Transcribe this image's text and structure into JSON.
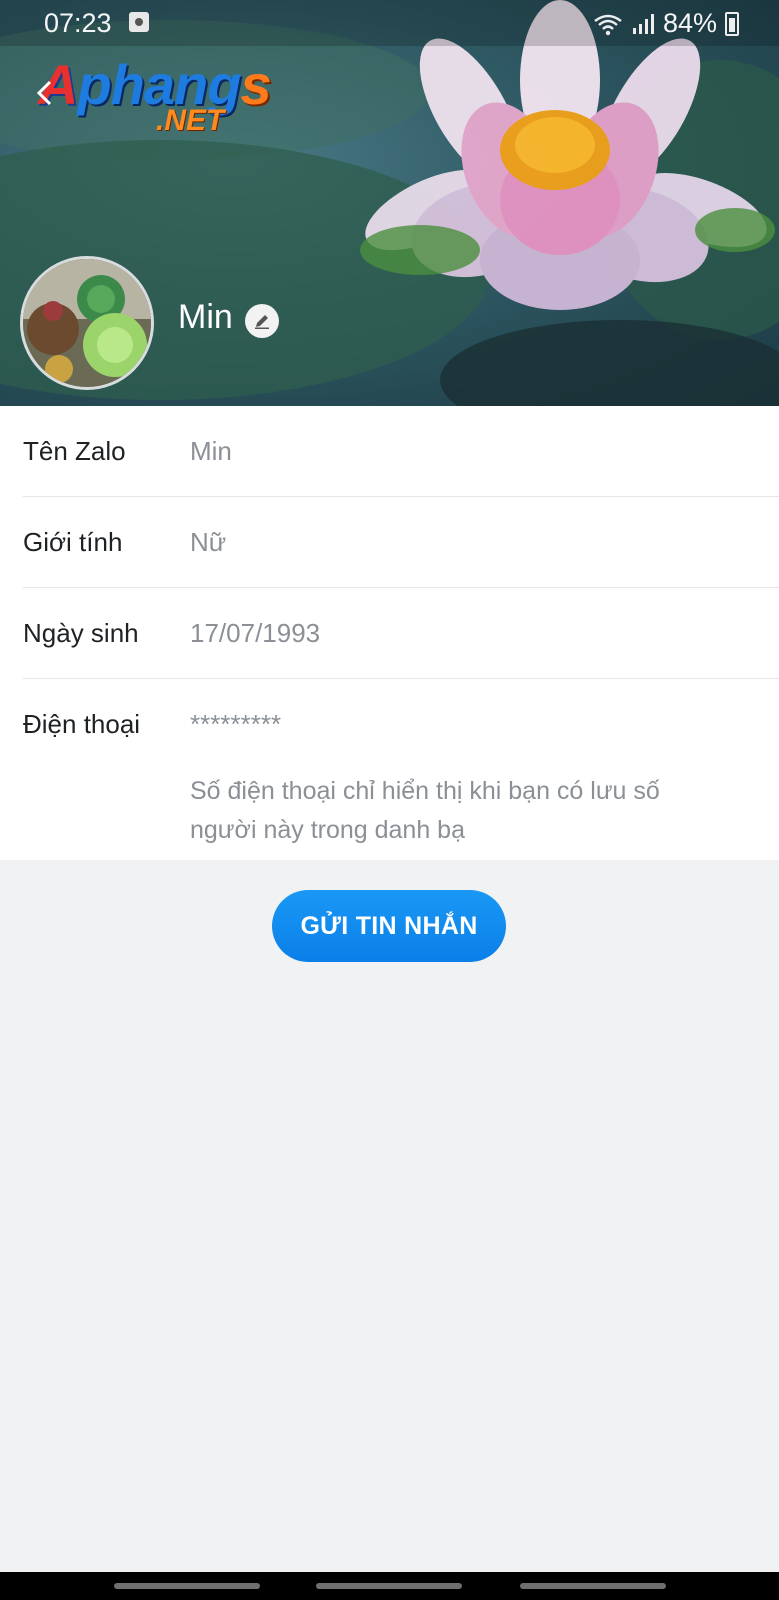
{
  "status_bar": {
    "time": "07:23",
    "battery": "84%"
  },
  "watermark": {
    "text_main_1": "A",
    "text_main_2": "phang",
    "text_main_3": "s",
    "text_net": ".NET"
  },
  "profile": {
    "name": "Min"
  },
  "info": {
    "rows": [
      {
        "label": "Tên Zalo",
        "value": "Min"
      },
      {
        "label": "Giới tính",
        "value": "Nữ"
      },
      {
        "label": "Ngày sinh",
        "value": "17/07/1993"
      },
      {
        "label": "Điện thoại",
        "value": "*********",
        "note": "Số điện thoại chỉ hiển thị khi bạn có lưu số người này trong danh bạ"
      }
    ]
  },
  "actions": {
    "send_message": "GỬI TIN NHẮN"
  },
  "colors": {
    "accent": "#0a85ea",
    "background": "#f1f2f4"
  }
}
